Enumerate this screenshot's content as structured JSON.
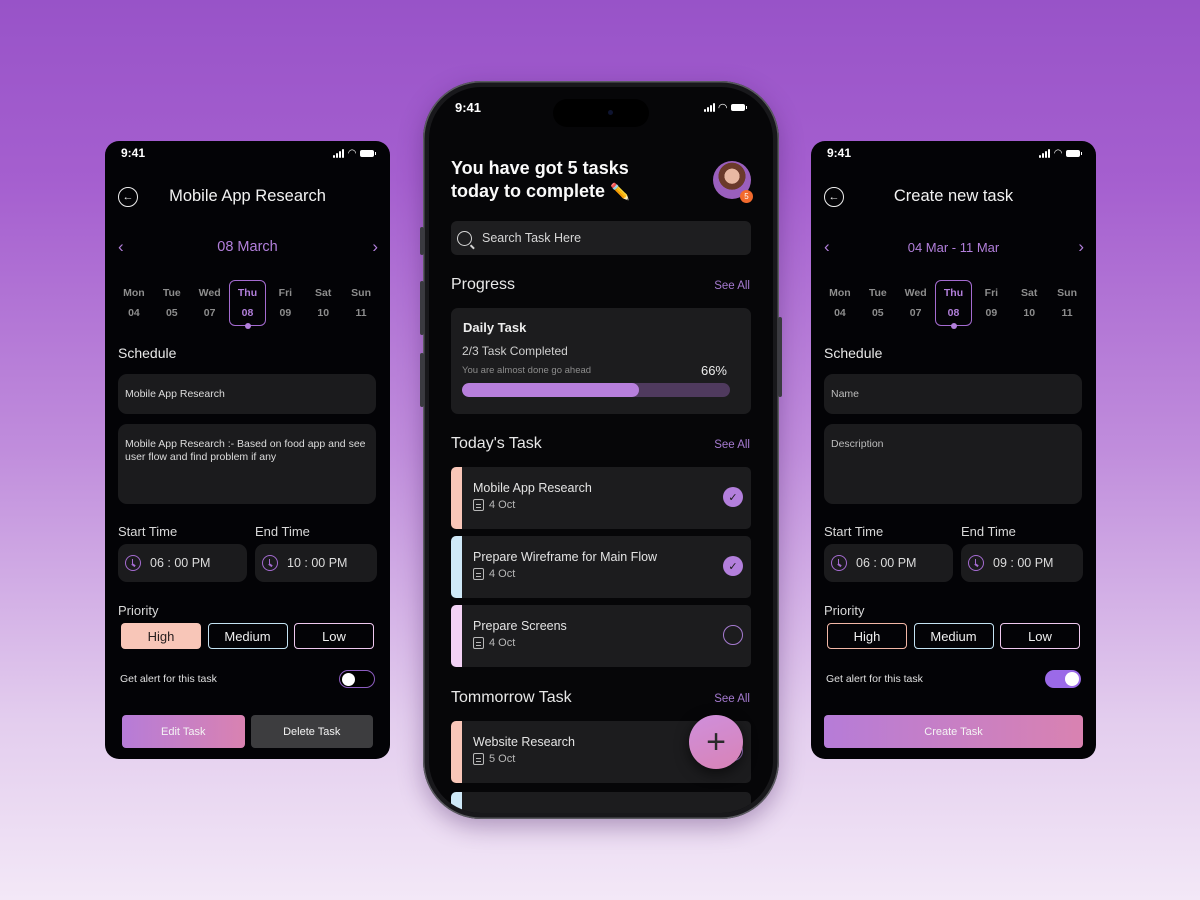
{
  "colors": {
    "accent": "#b27fdb",
    "high": "#f8c6b8",
    "medium": "#c4e3f3",
    "low": "#efc9ef",
    "badge": "#f26a2d"
  },
  "left_screen": {
    "status_time": "9:41",
    "title": "Mobile App Research",
    "month_label": "08 March",
    "week": [
      {
        "day": "Mon",
        "num": "04"
      },
      {
        "day": "Tue",
        "num": "05"
      },
      {
        "day": "Wed",
        "num": "07"
      },
      {
        "day": "Thu",
        "num": "08",
        "active": true
      },
      {
        "day": "Fri",
        "num": "09"
      },
      {
        "day": "Sat",
        "num": "10"
      },
      {
        "day": "Sun",
        "num": "11"
      }
    ],
    "schedule_label": "Schedule",
    "name_value": "Mobile App Research",
    "description_value": "Mobile App Research :- Based on food app and see user flow and find problem if any",
    "start_time_label": "Start Time",
    "start_time": "06 : 00 PM",
    "end_time_label": "End Time",
    "end_time": "10 : 00 PM",
    "priority_label": "Priority",
    "priorities": [
      "High",
      "Medium",
      "Low"
    ],
    "selected_priority": "High",
    "alert_label": "Get alert for this task",
    "alert_on": false,
    "edit_label": "Edit Task",
    "delete_label": "Delete Task"
  },
  "center_screen": {
    "status_time": "9:41",
    "greeting_line1": "You have got 5 tasks",
    "greeting_line2": "today to complete",
    "greeting_emoji": "✏️",
    "avatar_badge": "5",
    "search_placeholder": "Search Task Here",
    "progress_title": "Progress",
    "see_all": "See All",
    "progress_card": {
      "title": "Daily Task",
      "subtitle": "2/3 Task Completed",
      "hint": "You are almost done go ahead",
      "percent_label": "66%",
      "percent": 66
    },
    "today_title": "Today's Task",
    "today_tasks": [
      {
        "title": "Mobile App Research",
        "date": "4 Oct",
        "done": true,
        "color": "#f8c6b8"
      },
      {
        "title": "Prepare Wireframe for Main Flow",
        "date": "4 Oct",
        "done": true,
        "color": "#cfe9f8"
      },
      {
        "title": "Prepare Screens",
        "date": "4 Oct",
        "done": false,
        "color": "#f3d2f5"
      }
    ],
    "tomorrow_title": "Tommorrow Task",
    "tomorrow_tasks": [
      {
        "title": "Website Research",
        "date": "5 Oct",
        "done": false,
        "color": "#f8c6b8"
      }
    ],
    "fab_label": "+"
  },
  "right_screen": {
    "status_time": "9:41",
    "title": "Create new task",
    "month_label": "04 Mar - 11 Mar",
    "week": [
      {
        "day": "Mon",
        "num": "04"
      },
      {
        "day": "Tue",
        "num": "05"
      },
      {
        "day": "Wed",
        "num": "07"
      },
      {
        "day": "Thu",
        "num": "08",
        "active": true
      },
      {
        "day": "Fri",
        "num": "09"
      },
      {
        "day": "Sat",
        "num": "10"
      },
      {
        "day": "Sun",
        "num": "11"
      }
    ],
    "schedule_label": "Schedule",
    "name_placeholder": "Name",
    "description_placeholder": "Description",
    "start_time_label": "Start Time",
    "start_time": "06 : 00 PM",
    "end_time_label": "End Time",
    "end_time": "09 : 00 PM",
    "priority_label": "Priority",
    "priorities": [
      "High",
      "Medium",
      "Low"
    ],
    "alert_label": "Get alert for this task",
    "alert_on": true,
    "create_label": "Create Task"
  }
}
